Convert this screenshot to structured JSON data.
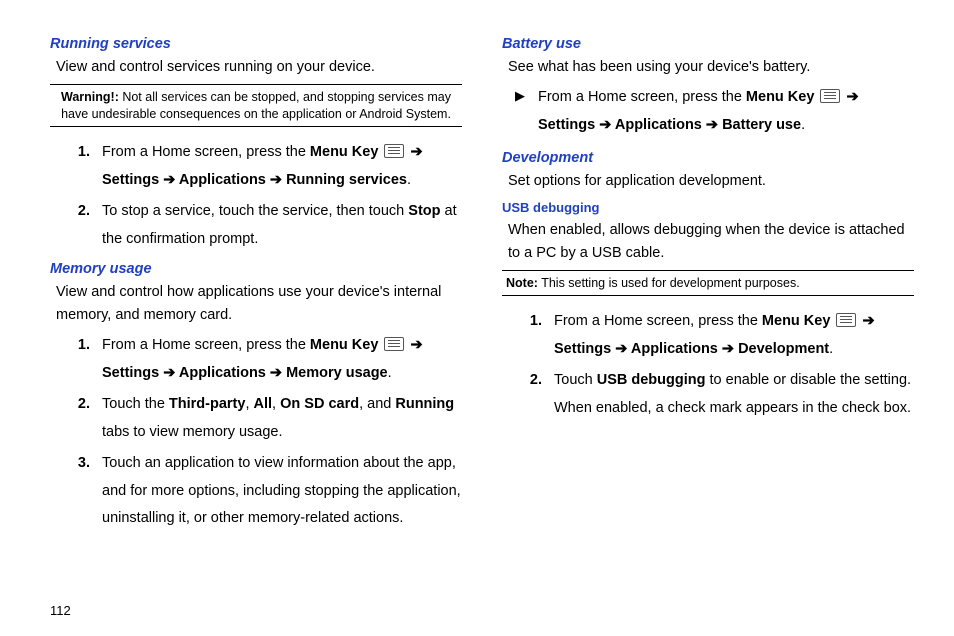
{
  "page_number": "112",
  "left": {
    "h1": "Running services",
    "p1": "View and control services running on your device.",
    "warn_label": "Warning!:",
    "warn_text": " Not all services can be stopped, and stopping services may have undesirable consequences on the application or Android System.",
    "steps1": {
      "n1": "1.",
      "s1a": "From a Home screen, press the ",
      "menu_key": "Menu Key",
      "arrow_settings": " ➔ Settings ➔ Applications ➔ Running services",
      "dot": ".",
      "n2": "2.",
      "s2a": "To stop a service, touch the service, then touch ",
      "stop": "Stop",
      "s2b": " at the confirmation prompt."
    },
    "h2": "Memory usage",
    "p2": "View and control how applications use your device's internal memory, and memory card.",
    "steps2": {
      "n1": "1.",
      "s1a": "From a Home screen, press the ",
      "menu_key": "Menu Key",
      "arrow_settings": " ➔ Settings ➔ Applications ➔ Memory usage",
      "dot": ".",
      "n2": "2.",
      "s2a": "Touch the ",
      "third": "Third-party",
      "c1": ", ",
      "all": "All",
      "c2": ", ",
      "sd": "On SD card",
      "c3": ", and ",
      "running": "Running",
      "s2b": " tabs to view memory usage.",
      "n3": "3.",
      "s3": "Touch an application to view information about the app, and for more options, including stopping the application, uninstalling it, or other memory-related actions."
    }
  },
  "right": {
    "h1": "Battery use",
    "p1": "See what has been using your device's battery.",
    "tri": "▶",
    "b1a": "From a Home screen, press the ",
    "menu_key": "Menu Key",
    "b1_settings": " ➔ Settings ➔ Applications ➔ Battery use",
    "dot": ".",
    "h2": "Development",
    "p2": "Set options for application development.",
    "h3": "USB debugging",
    "p3": "When enabled, allows debugging when the device is attached to a PC by a USB cable.",
    "note_label": "Note:",
    "note_text": " This setting is used for development purposes.",
    "steps": {
      "n1": "1.",
      "s1a": "From a Home screen, press the ",
      "menu_key": "Menu Key",
      "s1_settings": " ➔ Settings ➔ Applications ➔ Development",
      "dot": ".",
      "n2": "2.",
      "s2a": "Touch ",
      "usb": "USB debugging",
      "s2b": "  to enable or disable the setting. When enabled, a check mark appears in the check box."
    }
  }
}
